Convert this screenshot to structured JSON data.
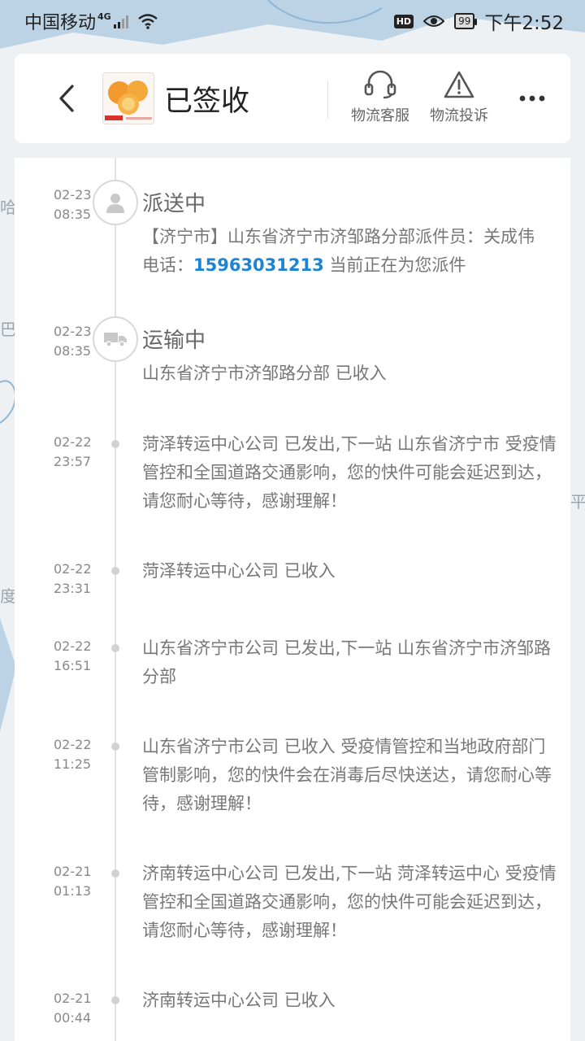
{
  "status_bar": {
    "carrier": "中国移动",
    "network": "4G",
    "hd_badge": "HD",
    "battery": "99",
    "time": "下午2:52"
  },
  "header": {
    "title": "已签收",
    "actions": [
      {
        "label": "物流客服",
        "icon": "headset-icon"
      },
      {
        "label": "物流投诉",
        "icon": "warning-triangle-icon"
      }
    ]
  },
  "map_labels": {
    "left_top": "哈",
    "left_mid": "巴",
    "left_low": "度",
    "right_mid": "平"
  },
  "colors": {
    "link": "#1e84d2",
    "map_water": "#bcd3e6",
    "map_land": "#eef1f3"
  },
  "events": [
    {
      "date": "02-23",
      "time": "08:35",
      "status": "派送中",
      "node_icon": "courier-person-icon",
      "desc_prefix": "【济宁市】山东省济宁市济邹路分部派件员：关成伟 电话：",
      "phone": "15963031213",
      "desc_suffix": " 当前正在为您派件"
    },
    {
      "date": "02-23",
      "time": "08:35",
      "status": "运输中",
      "node_icon": "truck-icon",
      "desc": "山东省济宁市济邹路分部 已收入"
    },
    {
      "date": "02-22",
      "time": "23:57",
      "desc": "菏泽转运中心公司 已发出,下一站 山东省济宁市 受疫情管控和全国道路交通影响，您的快件可能会延迟到达，请您耐心等待，感谢理解！"
    },
    {
      "date": "02-22",
      "time": "23:31",
      "desc": "菏泽转运中心公司 已收入"
    },
    {
      "date": "02-22",
      "time": "16:51",
      "desc": "山东省济宁市公司 已发出,下一站 山东省济宁市济邹路分部"
    },
    {
      "date": "02-22",
      "time": "11:25",
      "desc": "山东省济宁市公司 已收入 受疫情管控和当地政府部门管制影响，您的快件会在消毒后尽快送达，请您耐心等待，感谢理解！"
    },
    {
      "date": "02-21",
      "time": "01:13",
      "desc": "济南转运中心公司 已发出,下一站 菏泽转运中心 受疫情管控和全国道路交通影响，您的快件可能会延迟到达，请您耐心等待，感谢理解！"
    },
    {
      "date": "02-21",
      "time": "00:44",
      "desc": "济南转运中心公司 已收入"
    }
  ]
}
